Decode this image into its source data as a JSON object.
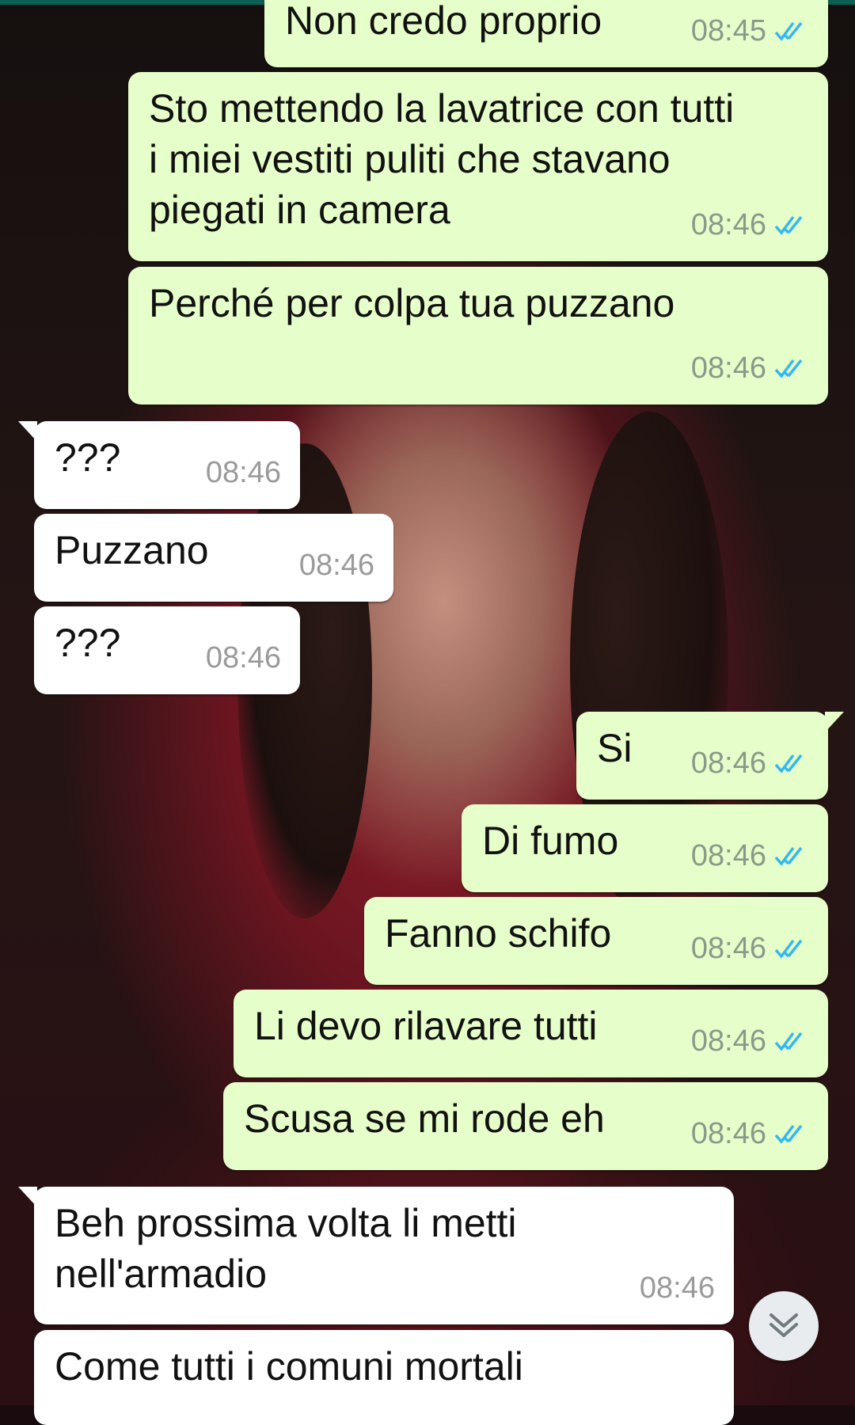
{
  "colors": {
    "outgoing_bubble": "#e6fec9",
    "incoming_bubble": "#ffffff",
    "read_ticks": "#34b7f1",
    "header_strip": "#0b5f53"
  },
  "messages": [
    {
      "dir": "out",
      "text": "Non credo proprio",
      "time": "08:45",
      "ticks": "double-check-read-icon"
    },
    {
      "dir": "out",
      "text": "Sto mettendo la lavatrice con tutti\ni miei vestiti puliti che stavano\npiegati in camera",
      "time": "08:46",
      "ticks": "double-check-read-icon"
    },
    {
      "dir": "out",
      "text": "Perché per colpa tua puzzano",
      "time": "08:46",
      "ticks": "double-check-read-icon"
    },
    {
      "dir": "in",
      "text": "???",
      "time": "08:46"
    },
    {
      "dir": "in",
      "text": "Puzzano",
      "time": "08:46"
    },
    {
      "dir": "in",
      "text": "???",
      "time": "08:46"
    },
    {
      "dir": "out",
      "text": "Si",
      "time": "08:46",
      "ticks": "double-check-read-icon"
    },
    {
      "dir": "out",
      "text": "Di fumo",
      "time": "08:46",
      "ticks": "double-check-read-icon"
    },
    {
      "dir": "out",
      "text": "Fanno schifo",
      "time": "08:46",
      "ticks": "double-check-read-icon"
    },
    {
      "dir": "out",
      "text": "Li devo rilavare tutti",
      "time": "08:46",
      "ticks": "double-check-read-icon"
    },
    {
      "dir": "out",
      "text": "Scusa se mi rode eh",
      "time": "08:46",
      "ticks": "double-check-read-icon"
    },
    {
      "dir": "in",
      "text": "Beh prossima volta li metti\nnell'armadio",
      "time": "08:46"
    },
    {
      "dir": "in",
      "text": "Come tutti i comuni mortali",
      "time": ""
    }
  ],
  "scroll_button": {
    "icon": "double-chevron-down-icon"
  }
}
